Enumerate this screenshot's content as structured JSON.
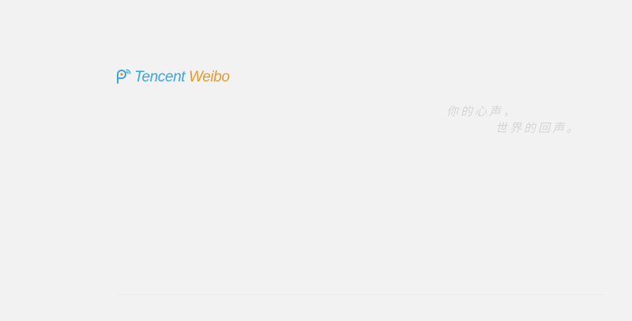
{
  "brand": {
    "word1": "Tencent",
    "word2": "Weibo",
    "logo_icon": "weibo-bubble-icon",
    "color_primary": "#3aa6dc",
    "color_accent": "#e69a2e"
  },
  "slogan": {
    "line1": "你的心声，",
    "line2": "世界的回声。",
    "color": "#d2d2d2"
  },
  "background": "#f2f2f2"
}
